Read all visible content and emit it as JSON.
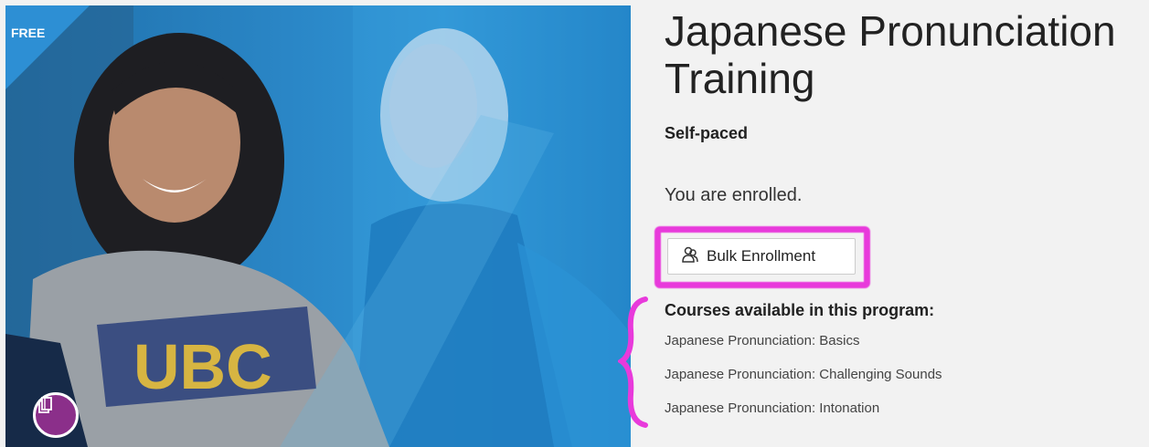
{
  "hero": {
    "ribbon_label": "FREE",
    "badge_icon": "books-icon"
  },
  "program": {
    "title_line1": "Japanese Pronunciation",
    "title_line2": "Training",
    "pace": "Self-paced",
    "status": "You are enrolled."
  },
  "bulk": {
    "icon": "users-icon",
    "label": "Bulk Enrollment"
  },
  "courses": {
    "heading": "Courses available in this program:",
    "items": [
      "Japanese Pronunciation: Basics",
      "Japanese Pronunciation: Challenging Sounds",
      "Japanese Pronunciation: Intonation"
    ]
  },
  "colors": {
    "highlight": "#e83adb",
    "hero_blue": "#2a86c6",
    "badge_purple": "#8b2f8a"
  }
}
